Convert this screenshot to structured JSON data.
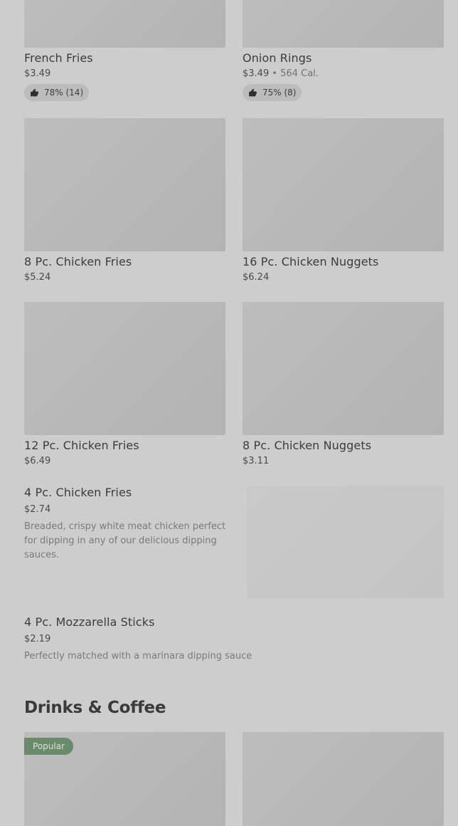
{
  "items": [
    {
      "name": "French Fries",
      "price": "$3.49",
      "rating": "78% (14)"
    },
    {
      "name": "Onion Rings",
      "price": "$3.49",
      "calories": "564 Cal.",
      "rating": "75% (8)"
    },
    {
      "name": "8 Pc. Chicken Fries",
      "price": "$5.24"
    },
    {
      "name": "16 Pc. Chicken Nuggets",
      "price": "$6.24"
    },
    {
      "name": "12 Pc. Chicken Fries",
      "price": "$6.49"
    },
    {
      "name": "8 Pc. Chicken Nuggets",
      "price": "$3.11"
    },
    {
      "name": "4 Pc. Chicken Fries",
      "price": "$2.74",
      "description": "Breaded, crispy white meat chicken perfect for dipping in any of our delicious dipping sauces."
    },
    {
      "name": "4 Pc. Mozzarella Sticks",
      "price": "$2.19",
      "description": "Perfectly matched with a marinara dipping sauce"
    }
  ],
  "sections": {
    "drinks_title": "Drinks & Coffee"
  },
  "badges": {
    "popular": "Popular"
  },
  "icons": {
    "rating": "thumbs-up-icon"
  },
  "colors": {
    "overlay": "#cdcdcd",
    "popular_badge": "#6b8a6b"
  }
}
